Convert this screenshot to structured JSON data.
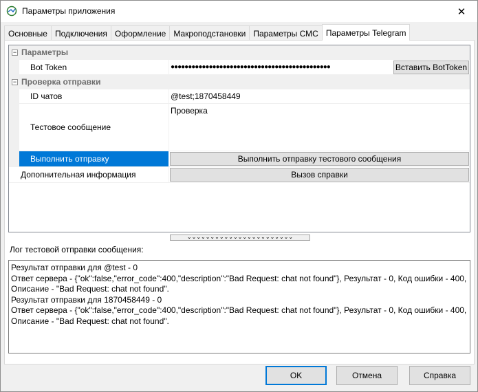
{
  "window": {
    "title": "Параметры приложения"
  },
  "tabs": [
    "Основные",
    "Подключения",
    "Оформление",
    "Макроподстановки",
    "Параметры СМС",
    "Параметры Telegram"
  ],
  "active_tab_index": 5,
  "grid": {
    "categories": {
      "params": "Параметры",
      "check": "Проверка отправки"
    },
    "bot_token": {
      "label": "Bot Token",
      "value": "●●●●●●●●●●●●●●●●●●●●●●●●●●●●●●●●●●●●●●●●●●●●●●",
      "button": "Вставить BotToken"
    },
    "chat_ids": {
      "label": "ID чатов",
      "value": "@test;1870458449"
    },
    "test_message": {
      "label": "Тестовое сообщение",
      "value": "Проверка"
    },
    "send": {
      "label": "Выполнить отправку",
      "button": "Выполнить отправку тестового сообщения"
    },
    "extra": {
      "label": "Допопнительная информация",
      "button": "Вызов справки"
    }
  },
  "log": {
    "label": "Лог тестовой отправки сообщения:",
    "lines": [
      "Результат отправки для @test - 0",
      "Ответ сервера - {\"ok\":false,\"error_code\":400,\"description\":\"Bad Request: chat not found\"}, Результат - 0, Код ошибки - 400,",
      "Описание - \"Bad Request: chat not found\".",
      "Результат отправки для 1870458449 - 0",
      "Ответ сервера - {\"ok\":false,\"error_code\":400,\"description\":\"Bad Request: chat not found\"}, Результат - 0, Код ошибки - 400,",
      "Описание - \"Bad Request: chat not found\"."
    ]
  },
  "buttons": {
    "ok": "OK",
    "cancel": "Отмена",
    "help": "Справка"
  },
  "colors": {
    "accent": "#0078d7",
    "selection_text": "#ffffff"
  }
}
